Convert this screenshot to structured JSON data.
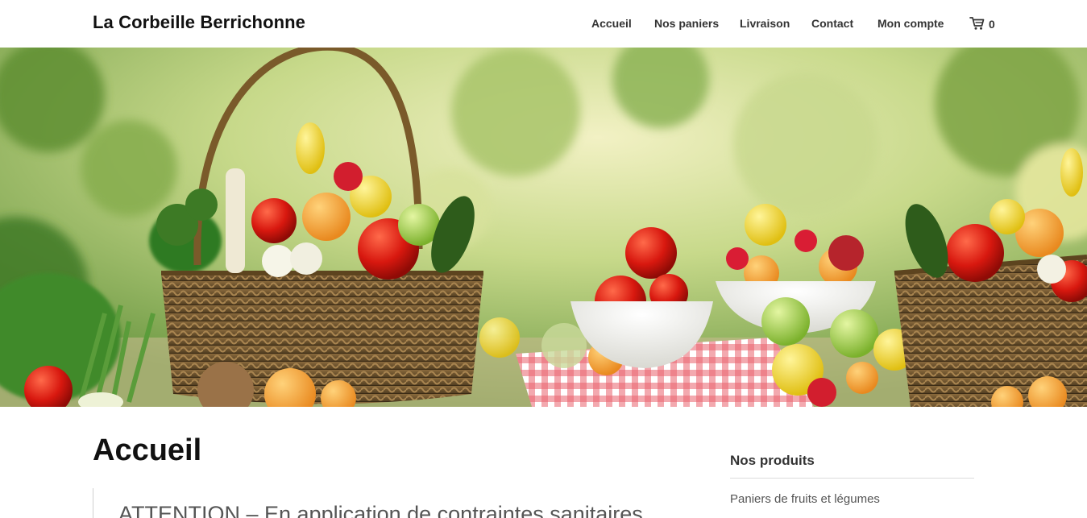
{
  "header": {
    "site_title": "La Corbeille Berrichonne",
    "nav": {
      "accueil": "Accueil",
      "nos_paniers": "Nos paniers",
      "livraison": "Livraison",
      "contact": "Contact",
      "mon_compte": "Mon compte"
    },
    "cart_count": "0",
    "cart_icon": "cart-icon"
  },
  "hero": {
    "image_subject": "baskets of fresh fruits and vegetables on a table"
  },
  "main": {
    "page_title": "Accueil",
    "notice_text": "ATTENTION – En application de contraintes sanitaires"
  },
  "sidebar": {
    "title": "Nos produits",
    "links": [
      "Paniers de fruits et légumes"
    ]
  },
  "colors": {
    "text_dark": "#111111",
    "nav_text": "#333333",
    "muted_text": "#555555",
    "divider": "#dcdcdc"
  }
}
